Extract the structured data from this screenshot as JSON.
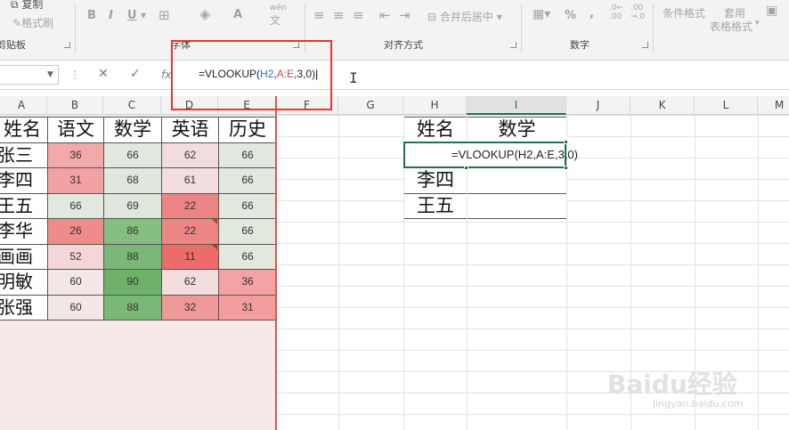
{
  "ribbon": {
    "copy": "复制",
    "format_painter": "格式刷",
    "clipboard": "剪贴板",
    "font_group": "字体",
    "align_group": "对齐方式",
    "number_group": "数字",
    "merge_center": "合并后居中",
    "cond_format": "条件格式",
    "table_format_1": "套用",
    "table_format_2": "表格格式",
    "bold": "B",
    "italic": "I",
    "underline": "U",
    "wen": "wén",
    "wen2": "文",
    "font_a": "A",
    "percent": "%",
    "comma": ","
  },
  "formula_bar": {
    "fx": "fx",
    "cancel": "✕",
    "enter": "✓",
    "f_pre": "=VLOOKUP(",
    "f_r1": "H2",
    ",": ",",
    "f_r2": "A:E",
    "f_post": ",3,0)"
  },
  "columns": [
    "A",
    "B",
    "C",
    "D",
    "E",
    "F",
    "G",
    "H",
    "I",
    "J",
    "K",
    "L",
    "M"
  ],
  "table": {
    "headers": [
      "姓名",
      "语文",
      "数学",
      "英语",
      "历史"
    ],
    "rows": [
      {
        "name": "张三",
        "v": [
          "36",
          "66",
          "62",
          "66"
        ]
      },
      {
        "name": "李四",
        "v": [
          "31",
          "68",
          "61",
          "66"
        ]
      },
      {
        "name": "王五",
        "v": [
          "66",
          "69",
          "22",
          "66"
        ]
      },
      {
        "name": "李华",
        "v": [
          "26",
          "86",
          "22",
          "66"
        ]
      },
      {
        "name": "画画",
        "v": [
          "52",
          "88",
          "11",
          "66"
        ]
      },
      {
        "name": "明敏",
        "v": [
          "60",
          "90",
          "62",
          "36"
        ]
      },
      {
        "name": "张强",
        "v": [
          "60",
          "88",
          "32",
          "31"
        ]
      }
    ],
    "colors": [
      [
        "#f1a9a9",
        "#e3e8df",
        "#f2dddd",
        "#e3e8df"
      ],
      [
        "#f2a2a2",
        "#e0e8dd",
        "#f2dede",
        "#e3e8df"
      ],
      [
        "#e3e8df",
        "#dfe7dc",
        "#ee8585",
        "#e3e8df"
      ],
      [
        "#ef8b8b",
        "#84bf7f",
        "#ee8585",
        "#e3e8df"
      ],
      [
        "#f4d6d6",
        "#79b975",
        "#ec6b6b",
        "#e3e8df"
      ],
      [
        "#f2e6e6",
        "#6db268",
        "#f2dddd",
        "#f3a3a3"
      ],
      [
        "#f2e6e6",
        "#79b975",
        "#ef9898",
        "#f39d9d"
      ]
    ]
  },
  "lookup": {
    "h_name": "姓名",
    "h_math": "数学",
    "active_formula": "=VLOOKUP(H2,A:E,3,0)",
    "rows": [
      "李四",
      "王五"
    ]
  },
  "watermark": {
    "main": "Baidu经验",
    "sub": "jingyan.baidu.com"
  }
}
